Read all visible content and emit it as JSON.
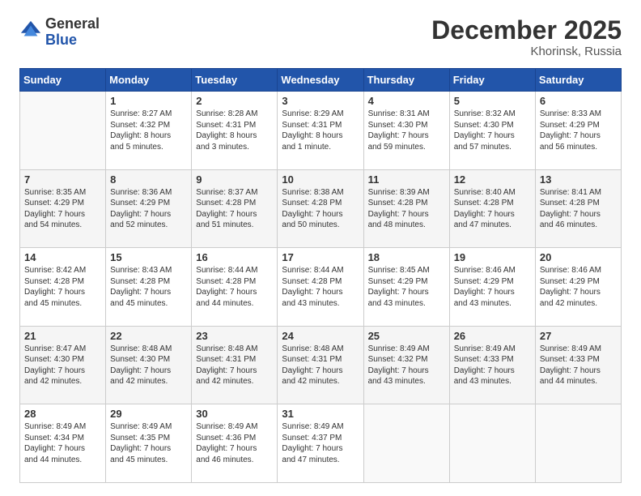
{
  "logo": {
    "general": "General",
    "blue": "Blue"
  },
  "header": {
    "month": "December 2025",
    "location": "Khorinsk, Russia"
  },
  "weekdays": [
    "Sunday",
    "Monday",
    "Tuesday",
    "Wednesday",
    "Thursday",
    "Friday",
    "Saturday"
  ],
  "weeks": [
    [
      {
        "day": "",
        "info": ""
      },
      {
        "day": "1",
        "info": "Sunrise: 8:27 AM\nSunset: 4:32 PM\nDaylight: 8 hours\nand 5 minutes."
      },
      {
        "day": "2",
        "info": "Sunrise: 8:28 AM\nSunset: 4:31 PM\nDaylight: 8 hours\nand 3 minutes."
      },
      {
        "day": "3",
        "info": "Sunrise: 8:29 AM\nSunset: 4:31 PM\nDaylight: 8 hours\nand 1 minute."
      },
      {
        "day": "4",
        "info": "Sunrise: 8:31 AM\nSunset: 4:30 PM\nDaylight: 7 hours\nand 59 minutes."
      },
      {
        "day": "5",
        "info": "Sunrise: 8:32 AM\nSunset: 4:30 PM\nDaylight: 7 hours\nand 57 minutes."
      },
      {
        "day": "6",
        "info": "Sunrise: 8:33 AM\nSunset: 4:29 PM\nDaylight: 7 hours\nand 56 minutes."
      }
    ],
    [
      {
        "day": "7",
        "info": "Sunrise: 8:35 AM\nSunset: 4:29 PM\nDaylight: 7 hours\nand 54 minutes."
      },
      {
        "day": "8",
        "info": "Sunrise: 8:36 AM\nSunset: 4:29 PM\nDaylight: 7 hours\nand 52 minutes."
      },
      {
        "day": "9",
        "info": "Sunrise: 8:37 AM\nSunset: 4:28 PM\nDaylight: 7 hours\nand 51 minutes."
      },
      {
        "day": "10",
        "info": "Sunrise: 8:38 AM\nSunset: 4:28 PM\nDaylight: 7 hours\nand 50 minutes."
      },
      {
        "day": "11",
        "info": "Sunrise: 8:39 AM\nSunset: 4:28 PM\nDaylight: 7 hours\nand 48 minutes."
      },
      {
        "day": "12",
        "info": "Sunrise: 8:40 AM\nSunset: 4:28 PM\nDaylight: 7 hours\nand 47 minutes."
      },
      {
        "day": "13",
        "info": "Sunrise: 8:41 AM\nSunset: 4:28 PM\nDaylight: 7 hours\nand 46 minutes."
      }
    ],
    [
      {
        "day": "14",
        "info": "Sunrise: 8:42 AM\nSunset: 4:28 PM\nDaylight: 7 hours\nand 45 minutes."
      },
      {
        "day": "15",
        "info": "Sunrise: 8:43 AM\nSunset: 4:28 PM\nDaylight: 7 hours\nand 45 minutes."
      },
      {
        "day": "16",
        "info": "Sunrise: 8:44 AM\nSunset: 4:28 PM\nDaylight: 7 hours\nand 44 minutes."
      },
      {
        "day": "17",
        "info": "Sunrise: 8:44 AM\nSunset: 4:28 PM\nDaylight: 7 hours\nand 43 minutes."
      },
      {
        "day": "18",
        "info": "Sunrise: 8:45 AM\nSunset: 4:29 PM\nDaylight: 7 hours\nand 43 minutes."
      },
      {
        "day": "19",
        "info": "Sunrise: 8:46 AM\nSunset: 4:29 PM\nDaylight: 7 hours\nand 43 minutes."
      },
      {
        "day": "20",
        "info": "Sunrise: 8:46 AM\nSunset: 4:29 PM\nDaylight: 7 hours\nand 42 minutes."
      }
    ],
    [
      {
        "day": "21",
        "info": "Sunrise: 8:47 AM\nSunset: 4:30 PM\nDaylight: 7 hours\nand 42 minutes."
      },
      {
        "day": "22",
        "info": "Sunrise: 8:48 AM\nSunset: 4:30 PM\nDaylight: 7 hours\nand 42 minutes."
      },
      {
        "day": "23",
        "info": "Sunrise: 8:48 AM\nSunset: 4:31 PM\nDaylight: 7 hours\nand 42 minutes."
      },
      {
        "day": "24",
        "info": "Sunrise: 8:48 AM\nSunset: 4:31 PM\nDaylight: 7 hours\nand 42 minutes."
      },
      {
        "day": "25",
        "info": "Sunrise: 8:49 AM\nSunset: 4:32 PM\nDaylight: 7 hours\nand 43 minutes."
      },
      {
        "day": "26",
        "info": "Sunrise: 8:49 AM\nSunset: 4:33 PM\nDaylight: 7 hours\nand 43 minutes."
      },
      {
        "day": "27",
        "info": "Sunrise: 8:49 AM\nSunset: 4:33 PM\nDaylight: 7 hours\nand 44 minutes."
      }
    ],
    [
      {
        "day": "28",
        "info": "Sunrise: 8:49 AM\nSunset: 4:34 PM\nDaylight: 7 hours\nand 44 minutes."
      },
      {
        "day": "29",
        "info": "Sunrise: 8:49 AM\nSunset: 4:35 PM\nDaylight: 7 hours\nand 45 minutes."
      },
      {
        "day": "30",
        "info": "Sunrise: 8:49 AM\nSunset: 4:36 PM\nDaylight: 7 hours\nand 46 minutes."
      },
      {
        "day": "31",
        "info": "Sunrise: 8:49 AM\nSunset: 4:37 PM\nDaylight: 7 hours\nand 47 minutes."
      },
      {
        "day": "",
        "info": ""
      },
      {
        "day": "",
        "info": ""
      },
      {
        "day": "",
        "info": ""
      }
    ]
  ]
}
